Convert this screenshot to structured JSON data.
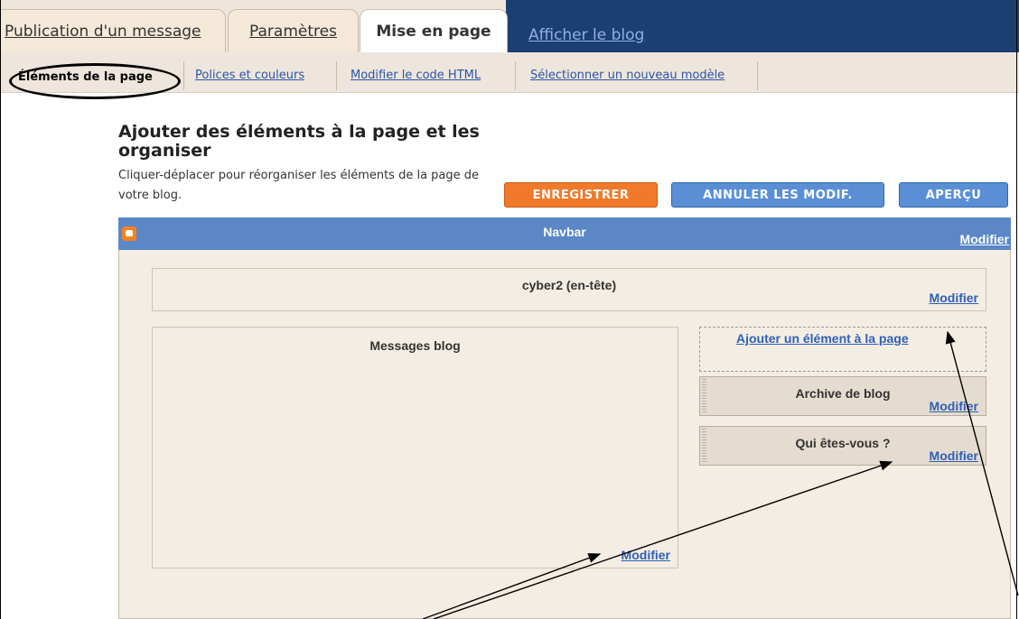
{
  "tabs": {
    "publication": "Publication d'un message",
    "parametres": "Paramètres",
    "mise_en_page": "Mise en page",
    "afficher": "Afficher le blog"
  },
  "subtabs": {
    "elements": "Éléments de la page",
    "polices": "Polices et couleurs",
    "html": "Modifier le code HTML",
    "modele": "Sélectionner un nouveau modèle"
  },
  "heading": {
    "title": "Ajouter des éléments à la page et les organiser",
    "subtitle": "Cliquer-déplacer pour réorganiser les éléments de la page de votre blog."
  },
  "buttons": {
    "save": "ENREGISTRER",
    "cancel": "ANNULER LES MODIF.",
    "preview": "APERÇU"
  },
  "layout": {
    "navbar_title": "Navbar",
    "header_title": "cyber2 (en-tête)",
    "posts_title": "Messages blog",
    "add_element": "Ajouter un élément à la page",
    "archive_title": "Archive de blog",
    "about_title": "Qui êtes-vous ?",
    "modify": "Modifier"
  },
  "colors": {
    "navbar": "#5b87c7",
    "save_button": "#f07a2a",
    "blue_button": "#5a8fd6",
    "top_bar_dark": "#1c3f73"
  }
}
